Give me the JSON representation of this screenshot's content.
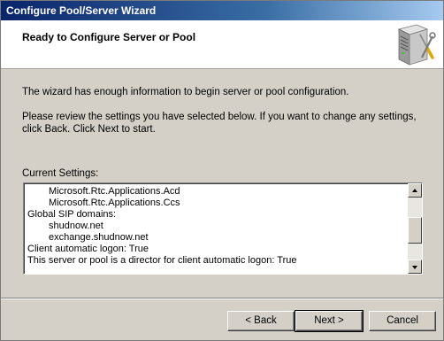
{
  "window": {
    "title": "Configure Pool/Server Wizard"
  },
  "header": {
    "heading": "Ready to Configure Server or Pool",
    "icon": "server-tools-icon"
  },
  "body": {
    "intro": "The wizard has enough information to begin server or pool configuration.",
    "review": "Please review the settings you have selected below. If you want to change any settings, click Back. Click Next to start.",
    "current_settings_label": "Current Settings:"
  },
  "settings": {
    "lines": [
      "Microsoft.Rtc.Applications.Acd",
      "Microsoft.Rtc.Applications.Ccs",
      "Global SIP domains:",
      "shudnow.net",
      "exchange.shudnow.net",
      "Client automatic logon: True",
      "This server or pool is a director for client automatic logon: True"
    ]
  },
  "buttons": {
    "back": "< Back",
    "next": "Next >",
    "cancel": "Cancel"
  },
  "colors": {
    "titlebar_start": "#0a246a",
    "titlebar_end": "#a6caf0",
    "dialog_bg": "#d4d0c8"
  }
}
